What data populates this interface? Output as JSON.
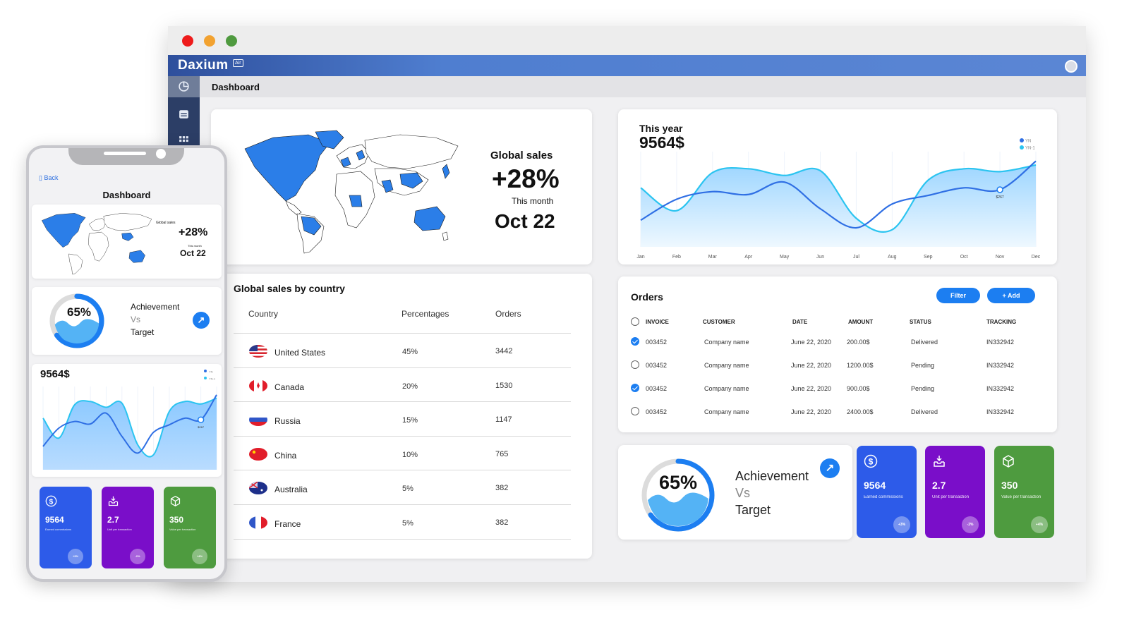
{
  "window": {
    "brand": "Daxium",
    "brand_tag": "Air",
    "page_title": "Dashboard"
  },
  "global_sales": {
    "label": "Global sales",
    "change": "+28%",
    "period": "This month",
    "date": "Oct 22"
  },
  "this_year": {
    "title": "This year",
    "value": "9564$",
    "point_label": "$267"
  },
  "chart_data": {
    "type": "line",
    "x": [
      "Jan",
      "Feb",
      "Mar",
      "Apr",
      "May",
      "Jun",
      "Jul",
      "Aug",
      "Sep",
      "Oct",
      "Nov",
      "Dec"
    ],
    "series": [
      {
        "name": "YN",
        "values": [
          28,
          50,
          58,
          55,
          68,
          40,
          20,
          45,
          54,
          62,
          60,
          90
        ]
      },
      {
        "name": "YN-1",
        "values": [
          62,
          38,
          78,
          82,
          75,
          80,
          30,
          18,
          70,
          82,
          79,
          86
        ]
      }
    ],
    "legend": "top-right",
    "colors": [
      "#2f6fe4",
      "#2bc4f0"
    ]
  },
  "country_table": {
    "title": "Global sales by country",
    "headers": {
      "country": "Country",
      "pct": "Percentages",
      "orders": "Orders"
    },
    "rows": [
      {
        "country": "United States",
        "pct": "45%",
        "orders": "3442",
        "flag": "us"
      },
      {
        "country": "Canada",
        "pct": "20%",
        "orders": "1530",
        "flag": "ca"
      },
      {
        "country": "Russia",
        "pct": "15%",
        "orders": "1147",
        "flag": "ru"
      },
      {
        "country": "China",
        "pct": "10%",
        "orders": "765",
        "flag": "cn"
      },
      {
        "country": "Australia",
        "pct": "5%",
        "orders": "382",
        "flag": "au"
      },
      {
        "country": "France",
        "pct": "5%",
        "orders": "382",
        "flag": "fr"
      }
    ]
  },
  "orders": {
    "title": "Orders",
    "filter_label": "Filter",
    "add_label": "+ Add",
    "headers": {
      "invoice": "INVOICE",
      "customer": "CUSTOMER",
      "date": "DATE",
      "amount": "AMOUNT",
      "status": "STATUS",
      "tracking": "TRACKING"
    },
    "rows": [
      {
        "checked": true,
        "invoice": "003452",
        "customer": "Company name",
        "date": "June 22, 2020",
        "amount": "200.00$",
        "status": "Delivered",
        "tracking": "IN332942"
      },
      {
        "checked": false,
        "invoice": "003452",
        "customer": "Company name",
        "date": "June 22, 2020",
        "amount": "1200.00$",
        "status": "Pending",
        "tracking": "IN332942"
      },
      {
        "checked": true,
        "invoice": "003452",
        "customer": "Company name",
        "date": "June 22, 2020",
        "amount": "900.00$",
        "status": "Pending",
        "tracking": "IN332942"
      },
      {
        "checked": false,
        "invoice": "003452",
        "customer": "Company name",
        "date": "June 22, 2020",
        "amount": "2400.00$",
        "status": "Delivered",
        "tracking": "IN332942"
      }
    ]
  },
  "achievement": {
    "percent": 65,
    "percent_label": "65%",
    "line1": "Achievement",
    "line2": "Vs",
    "line3": "Target"
  },
  "tiles": [
    {
      "value": "9564",
      "label": "Earned commissions",
      "badge": "+3%",
      "color": "#2d5be9",
      "icon": "dollar-icon"
    },
    {
      "value": "2.7",
      "label": "Unit per transaction",
      "badge": "-2%",
      "color": "#7a0ec9",
      "icon": "inbox-download-icon"
    },
    {
      "value": "350",
      "label": "Value per transaction",
      "badge": "+4%",
      "color": "#4e9b3f",
      "icon": "cubes-icon"
    }
  ],
  "mobile": {
    "back_label": "Back",
    "title": "Dashboard"
  },
  "colors": {
    "accent": "#1c7ef1",
    "map_highlight": "#2b7ee8",
    "appbar": "#4f7ed0"
  }
}
